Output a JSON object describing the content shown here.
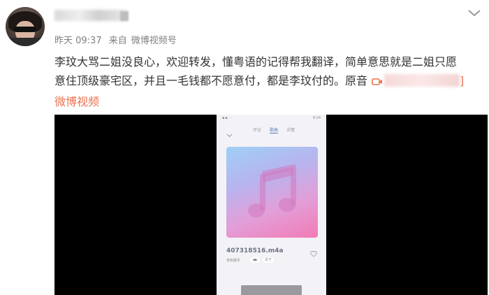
{
  "post": {
    "timestamp": "昨天 09:37",
    "source_prefix": "来自",
    "source_name": "微博视频号",
    "text_line1": "李玟大骂二姐没良心，欢迎转发，懂粤语的记得帮我翻译，简单意思就是二姐只愿",
    "text_line2": "意住顶级豪宅区，并且一毛钱都不愿意付，都是李玟付的。原音",
    "link_end": "]",
    "text_line3": "微博视频"
  },
  "video": {
    "status_right": "9:24",
    "tabs": [
      "评论",
      "歌曲",
      "详情"
    ],
    "active_tab": 1,
    "file_name": "407318516.m4a",
    "artist": "未知歌手",
    "pill_a": "◀▶",
    "pill_b": "关于"
  },
  "colors": {
    "link": "#eb7350",
    "text": "#333333",
    "meta": "#808080"
  },
  "icons": [
    "more-chevron-icon",
    "video-camera-icon",
    "music-note-icon",
    "heart-icon",
    "chevron-down-icon"
  ]
}
